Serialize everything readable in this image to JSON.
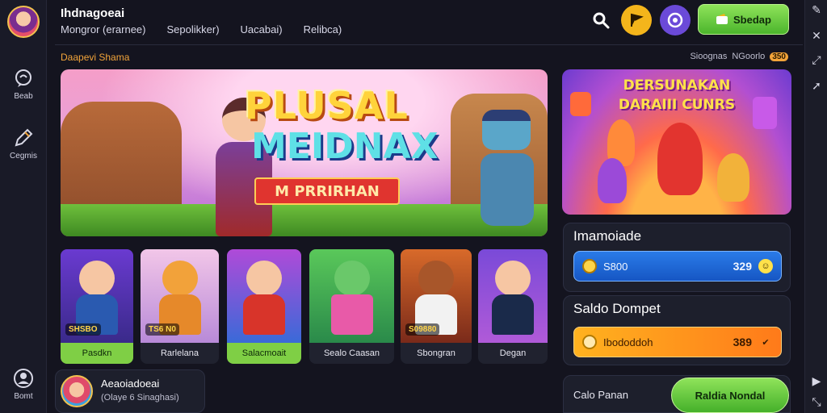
{
  "header": {
    "brand": "Ihdnagoeai",
    "nav": [
      "Mongror (erarnee)",
      "Sepolikker)",
      "Uacabai)",
      "Relibca)"
    ],
    "deposit_label": "Sbedap"
  },
  "left_rail": {
    "items": [
      {
        "label": "Beab",
        "icon": "chat-bubble-icon"
      },
      {
        "label": "Cegmis",
        "icon": "edit-icon"
      },
      {
        "label": "Bomt",
        "icon": "user-icon"
      }
    ]
  },
  "section": {
    "title": "Daapevi Shama",
    "meta_left": "Sioognas",
    "meta_mid": "NGoorlo",
    "meta_pill": "350"
  },
  "hero": {
    "title": "PLUSAL",
    "subtitle": "MEIDNAX",
    "ribbon": "M PRRIRHAN"
  },
  "promo": {
    "line1": "DERSUNAKAN",
    "line2": "DARAIII CUNRS"
  },
  "games": [
    {
      "name": "Pasdkn",
      "tag": "SHSBO",
      "active": true
    },
    {
      "name": "Rarlelana",
      "tag": "TS6 N0",
      "active": false
    },
    {
      "name": "Salacmoait",
      "tag": "",
      "active": true
    },
    {
      "name": "Sealo Caasan",
      "tag": "",
      "active": false
    },
    {
      "name": "Sbongran",
      "tag": "S09880",
      "active": false
    },
    {
      "name": "Degan",
      "tag": "",
      "active": false
    }
  ],
  "balance_panel": {
    "title": "Imamoiade",
    "label": "S800",
    "amount": "329"
  },
  "wallet_panel": {
    "title": "Saldo Dompet",
    "label": "Ibododdoh",
    "amount": "389"
  },
  "user_card": {
    "name": "Aeaoiadoeai",
    "sub": "(Olaye 6 Sinaghasi)"
  },
  "bottom_action": {
    "label": "Calo Panan",
    "button": "Raldia Nondal"
  },
  "colors": {
    "accent_green": "#7fcf45",
    "accent_orange": "#f2a43a",
    "accent_blue": "#2a7be8",
    "background": "#14141f"
  }
}
